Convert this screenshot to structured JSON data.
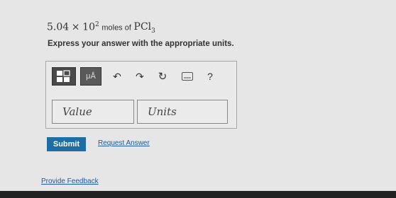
{
  "question": {
    "coefficient": "5.04",
    "times": "×",
    "base": "10",
    "exponent": "2",
    "unit_text": "moles of",
    "compound_main": "PCl",
    "compound_sub": "3"
  },
  "instruction": "Express your answer with the appropriate units.",
  "toolbar": {
    "units_label": "μÅ",
    "undo_symbol": "↶",
    "redo_symbol": "↷",
    "reset_symbol": "↻",
    "help_label": "?"
  },
  "fields": {
    "value_placeholder": "Value",
    "units_placeholder": "Units"
  },
  "actions": {
    "submit_label": "Submit",
    "request_answer_label": "Request Answer"
  },
  "footer": {
    "feedback_label": "Provide Feedback"
  },
  "colors": {
    "submit_bg": "#1e6ea5",
    "link": "#1e5aa0",
    "page_bg": "#e6e6e6"
  }
}
